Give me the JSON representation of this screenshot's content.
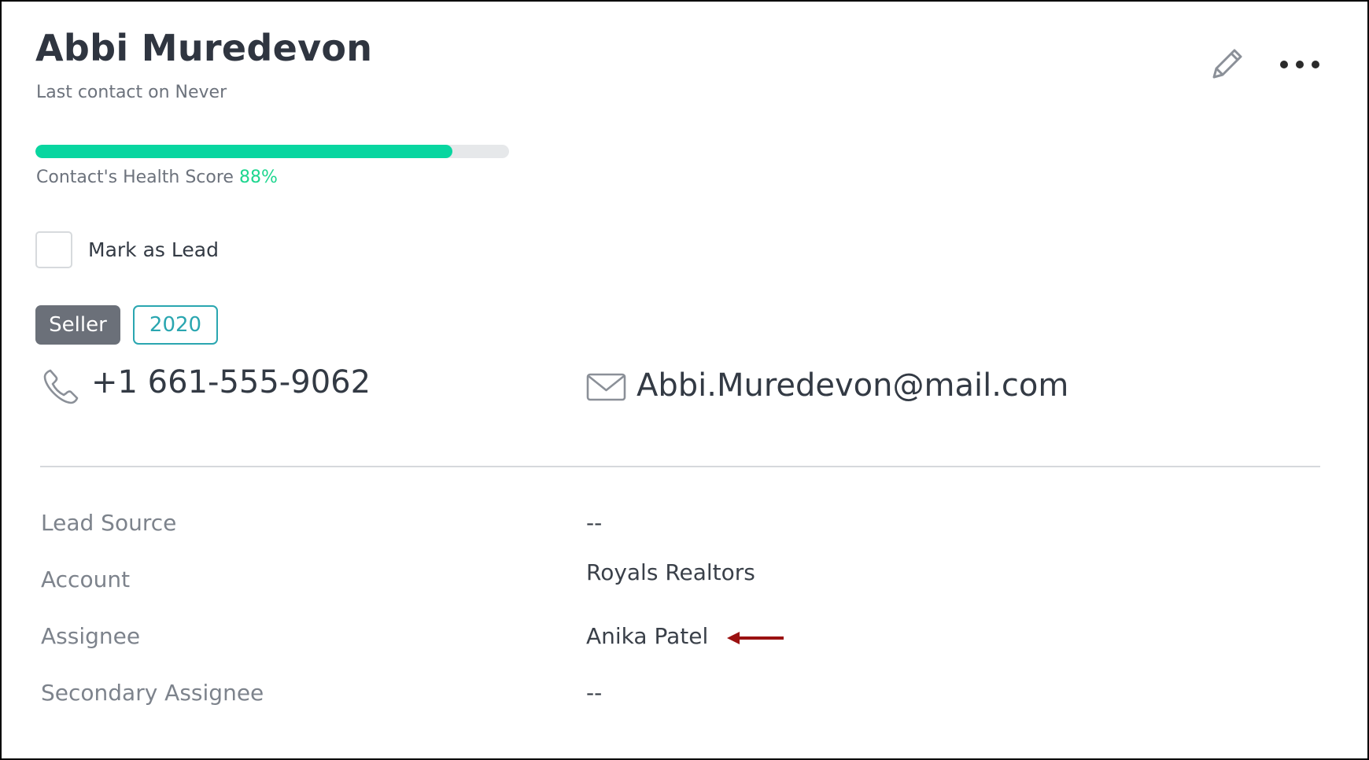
{
  "contact": {
    "name": "Abbi Muredevon",
    "last_contact": "Last contact on Never"
  },
  "actions": {
    "edit_icon": "pencil-icon",
    "more_icon": "more-horizontal-icon"
  },
  "health": {
    "label": "Contact's Health Score",
    "value_text": "88%",
    "value_fraction": 0.88,
    "fill_color": "#08d6a0",
    "value_color": "#1ed68f"
  },
  "mark_as_lead": {
    "label": "Mark as Lead",
    "checked": false
  },
  "tags": [
    {
      "label": "Seller",
      "style": "filled",
      "color": "#6b7079"
    },
    {
      "label": "2020",
      "style": "outline",
      "color": "#2aa6b0"
    }
  ],
  "contact_info": {
    "phone": "+1 661-555-9062",
    "phone_icon": "phone-icon",
    "email": "Abbi.Muredevon@mail.com",
    "email_icon": "mail-icon"
  },
  "fields": [
    {
      "label": "Lead Source",
      "value": "--"
    },
    {
      "label": "Account",
      "value": "Royals Realtors"
    },
    {
      "label": "Assignee",
      "value": "Anika Patel"
    },
    {
      "label": "Secondary Assignee",
      "value": "--"
    }
  ],
  "annotation": {
    "icon": "red-arrow-left-icon",
    "color": "#9b1111"
  }
}
